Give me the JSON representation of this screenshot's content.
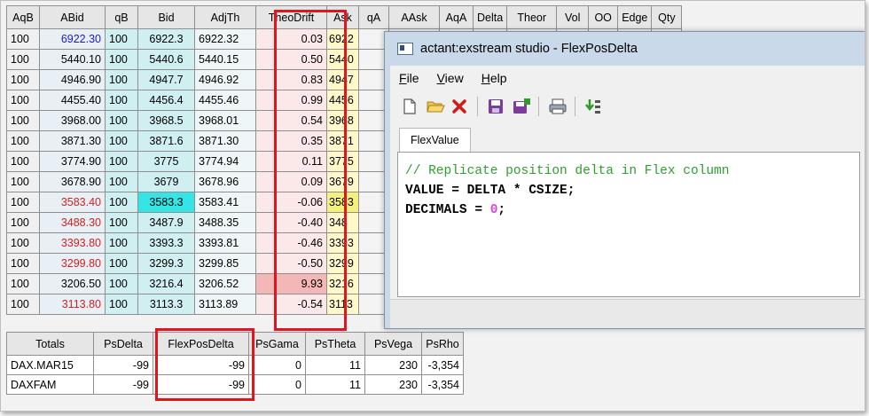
{
  "grid": {
    "headers": [
      "AqB",
      "ABid",
      "qB",
      "Bid",
      "AdjTh",
      "TheoDrift",
      "Ask",
      "qA",
      "AAsk",
      "AqA",
      "Delta",
      "Theor",
      "Vol",
      "OO",
      "Edge",
      "Qty"
    ],
    "rows": [
      {
        "aqb": "100",
        "abid": "6922.30",
        "qb": "100",
        "bid": "6922.3",
        "adjth": "6922.32",
        "theo": "0.03",
        "ask": "6922"
      },
      {
        "aqb": "100",
        "abid": "5440.10",
        "qb": "100",
        "bid": "5440.6",
        "adjth": "5440.15",
        "theo": "0.50",
        "ask": "5440"
      },
      {
        "aqb": "100",
        "abid": "4946.90",
        "qb": "100",
        "bid": "4947.7",
        "adjth": "4946.92",
        "theo": "0.83",
        "ask": "4947"
      },
      {
        "aqb": "100",
        "abid": "4455.40",
        "qb": "100",
        "bid": "4456.4",
        "adjth": "4455.46",
        "theo": "0.99",
        "ask": "4456"
      },
      {
        "aqb": "100",
        "abid": "3968.00",
        "qb": "100",
        "bid": "3968.5",
        "adjth": "3968.01",
        "theo": "0.54",
        "ask": "3968"
      },
      {
        "aqb": "100",
        "abid": "3871.30",
        "qb": "100",
        "bid": "3871.6",
        "adjth": "3871.30",
        "theo": "0.35",
        "ask": "3871"
      },
      {
        "aqb": "100",
        "abid": "3774.90",
        "qb": "100",
        "bid": "3775",
        "adjth": "3774.94",
        "theo": "0.11",
        "ask": "3775"
      },
      {
        "aqb": "100",
        "abid": "3678.90",
        "qb": "100",
        "bid": "3679",
        "adjth": "3678.96",
        "theo": "0.09",
        "ask": "3679"
      },
      {
        "aqb": "100",
        "abid": "3583.40",
        "qb": "100",
        "bid": "3583.3",
        "adjth": "3583.41",
        "theo": "-0.06",
        "ask": "3583"
      },
      {
        "aqb": "100",
        "abid": "3488.30",
        "qb": "100",
        "bid": "3487.9",
        "adjth": "3488.35",
        "theo": "-0.40",
        "ask": "348"
      },
      {
        "aqb": "100",
        "abid": "3393.80",
        "qb": "100",
        "bid": "3393.3",
        "adjth": "3393.81",
        "theo": "-0.46",
        "ask": "3393"
      },
      {
        "aqb": "100",
        "abid": "3299.80",
        "qb": "100",
        "bid": "3299.3",
        "adjth": "3299.85",
        "theo": "-0.50",
        "ask": "3299"
      },
      {
        "aqb": "100",
        "abid": "3206.50",
        "qb": "100",
        "bid": "3216.4",
        "adjth": "3206.52",
        "theo": "9.93",
        "ask": "3216"
      },
      {
        "aqb": "100",
        "abid": "3113.80",
        "qb": "100",
        "bid": "3113.3",
        "adjth": "3113.89",
        "theo": "-0.54",
        "ask": "3113"
      }
    ]
  },
  "totals": {
    "headers": [
      "Totals",
      "PsDelta",
      "FlexPosDelta",
      "PsGama",
      "PsTheta",
      "PsVega",
      "PsRho"
    ],
    "rows": [
      {
        "name": "DAX.MAR15",
        "psdelta": "-99",
        "flex": "-99",
        "psgama": "0",
        "pstheta": "11",
        "psvega": "230",
        "psrho": "-3,354"
      },
      {
        "name": "DAXFAM",
        "psdelta": "-99",
        "flex": "-99",
        "psgama": "0",
        "pstheta": "11",
        "psvega": "230",
        "psrho": "-3,354"
      }
    ]
  },
  "window": {
    "title": "actant:exstream studio - FlexPosDelta",
    "menu": [
      "File",
      "View",
      "Help"
    ],
    "toolbar_icons": [
      "new-file-icon",
      "open-folder-icon",
      "delete-icon",
      "save-icon",
      "save-all-icon",
      "print-icon",
      "import-icon"
    ],
    "tab_label": "FlexValue",
    "code": {
      "comment": "// Replicate position delta in Flex column",
      "line2": "VALUE = DELTA * CSIZE;",
      "line3_prefix": "DECIMALS = ",
      "line3_number": "0",
      "line3_suffix": ";"
    }
  },
  "colors": {
    "highlight_red": "#e3141b",
    "blue_value": "#1a1ad6",
    "red_value": "#d42020",
    "bid_highlight": "#35e4e4",
    "theo_highlight": "#f4b7b7",
    "ask_highlight": "#f5f07e"
  }
}
